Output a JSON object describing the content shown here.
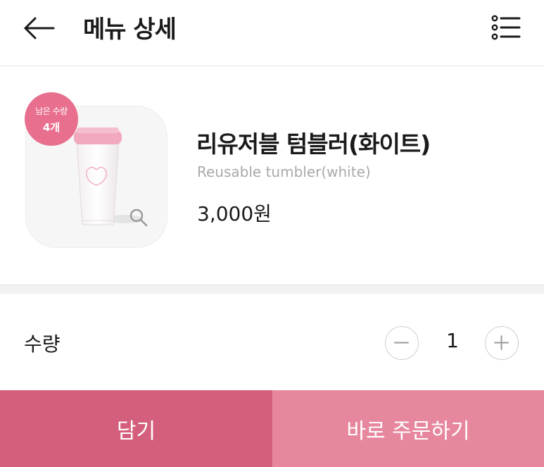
{
  "header": {
    "title": "메뉴 상세",
    "back_icon": "arrow-left-icon",
    "menu_icon": "list-icon"
  },
  "product": {
    "stock_label": "남은 수량",
    "stock_count": "4개",
    "name_ko": "리유저블 텀블러(화이트)",
    "name_en": "Reusable tumbler(white)",
    "price": "3,000원",
    "zoom_icon": "magnifier-icon"
  },
  "quantity": {
    "label": "수량",
    "value": "1",
    "minus_icon": "minus-icon",
    "plus_icon": "plus-icon"
  },
  "actions": {
    "add_to_cart": "담기",
    "order_now": "바로 주문하기"
  },
  "colors": {
    "badge": "#e86f8e",
    "cart_button": "#d45f7c",
    "order_button": "#e6879e"
  }
}
